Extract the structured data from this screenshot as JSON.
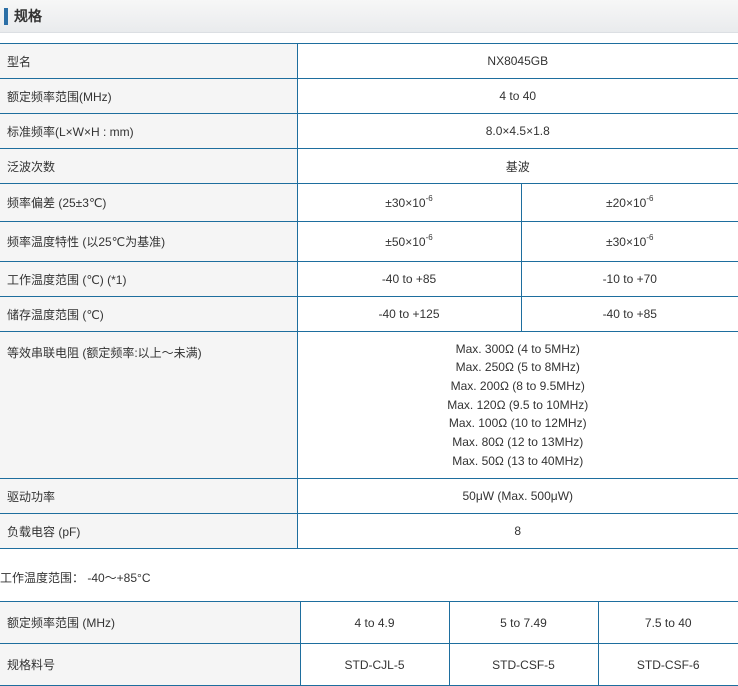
{
  "section": {
    "title": "规格"
  },
  "spec": {
    "model_label": "型名",
    "model_value": "NX8045GB",
    "freq_range_label": "额定频率范围(MHz)",
    "freq_range_value": "4 to 40",
    "size_label": "标准频率(L×W×H : mm)",
    "size_value": "8.0×4.5×1.8",
    "overtone_label": "泛波次数",
    "overtone_value": "基波",
    "tolerance_label": "频率偏差 (25±3℃)",
    "tolerance_a": "±30×10",
    "tolerance_b": "±20×10",
    "temp_char_label": "频率温度特性 (以25℃为基准)",
    "temp_char_a": "±50×10",
    "temp_char_b": "±30×10",
    "exponent": "-6",
    "op_temp_label": "工作温度范围 (℃) (*1)",
    "op_temp_a": "-40 to +85",
    "op_temp_b": "-10 to +70",
    "storage_label": "储存温度范围 (℃)",
    "storage_a": "-40 to +125",
    "storage_b": "-40 to +85",
    "esr_label": "等效串联电阻 (额定频率:以上～未满)",
    "esr_lines": [
      "Max. 300Ω (4 to 5MHz)",
      "Max. 250Ω (5 to 8MHz)",
      "Max. 200Ω (8 to 9.5MHz)",
      "Max. 120Ω (9.5 to 10MHz)",
      "Max. 100Ω (10 to 12MHz)",
      "Max. 80Ω (12 to 13MHz)",
      "Max. 50Ω (13 to 40MHz)"
    ],
    "drive_label": "驱动功率",
    "drive_value": "50μW (Max. 500μW)",
    "load_label": "负载电容 (pF)",
    "load_value": "8"
  },
  "note": "工作温度范围： -40～+85°C",
  "parts": {
    "range_label": "额定频率范围 (MHz)",
    "ranges": [
      "4 to 4.9",
      "5 to 7.49",
      "7.5 to 40"
    ],
    "part_label": "规格料号",
    "parts": [
      "STD-CJL-5",
      "STD-CSF-5",
      "STD-CSF-6"
    ]
  }
}
